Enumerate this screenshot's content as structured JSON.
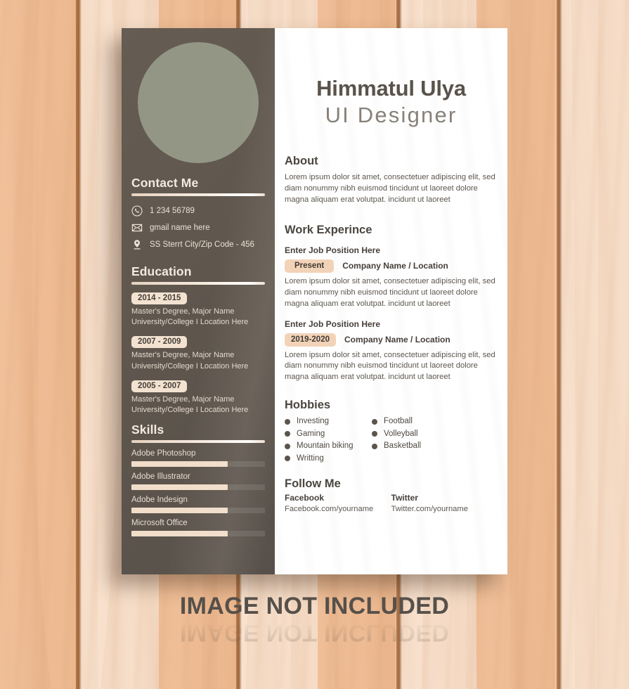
{
  "background": {
    "type": "wood-planks",
    "plank_colors": [
      "#f0c09a",
      "#f8e2cf"
    ],
    "seam_color": "#a36434"
  },
  "card": {
    "left_panel_color": "#5e564d",
    "right_panel_color": "#ffffff",
    "avatar_color": "#939684",
    "accent_light": "#f3e2d0",
    "accent_peach": "#f2d3b8"
  },
  "header": {
    "name": "Himmatul Ulya",
    "title": "UI Designer"
  },
  "sidebar": {
    "avatar_name": "profile-photo-placeholder",
    "contact": {
      "heading": "Contact Me",
      "items": [
        {
          "icon": "phone-icon",
          "value": "1 234 56789"
        },
        {
          "icon": "email-icon",
          "value": "gmail name here"
        },
        {
          "icon": "location-icon",
          "value": "SS Sterrt City/Zip Code - 456"
        }
      ]
    },
    "education": {
      "heading": "Education",
      "items": [
        {
          "dates": "2014 - 2015",
          "degree": "Master's Degree, Major Name",
          "institution": "University/College I  Location Here"
        },
        {
          "dates": "2007 - 2009",
          "degree": "Master's Degree, Major Name",
          "institution": "University/College I  Location Here"
        },
        {
          "dates": "2005 - 2007",
          "degree": "Master's Degree, Major Name",
          "institution": "University/College I  Location Here"
        }
      ]
    },
    "skills": {
      "heading": "Skills",
      "items": [
        {
          "name": "Adobe Photoshop",
          "percent": 72
        },
        {
          "name": "Adobe Illustrator",
          "percent": 72
        },
        {
          "name": "Adobe Indesign",
          "percent": 72
        },
        {
          "name": "Microsoft Office",
          "percent": 72
        }
      ]
    }
  },
  "main": {
    "about": {
      "heading": "About",
      "text": "Lorem ipsum dolor sit amet, consectetuer adipiscing elit, sed diam nonummy nibh euismod tincidunt ut laoreet dolore magna aliquam erat volutpat. incidunt ut laoreet"
    },
    "experience": {
      "heading": "Work Experince",
      "items": [
        {
          "position": "Enter Job Position Here",
          "dates": "Present",
          "company": "Company Name / Location",
          "text": "Lorem ipsum dolor sit amet, consectetuer adipiscing elit, sed diam nonummy nibh euismod tincidunt ut laoreet dolore magna aliquam erat volutpat. incidunt ut laoreet"
        },
        {
          "position": "Enter Job Position Here",
          "dates": "2019-2020",
          "company": "Company Name / Location",
          "text": "Lorem ipsum dolor sit amet, consectetuer adipiscing elit, sed diam nonummy nibh euismod tincidunt ut laoreet dolore magna aliquam erat volutpat. incidunt ut laoreet"
        }
      ]
    },
    "hobbies": {
      "heading": "Hobbies",
      "column_one": [
        "Investing",
        "Gaming",
        "Mountain biking",
        "Writting"
      ],
      "column_two": [
        "Football",
        "Volleyball",
        "Basketball"
      ]
    },
    "follow": {
      "heading": "Follow Me",
      "items": [
        {
          "network": "Facebook",
          "handle": "Facebook.com/yourname"
        },
        {
          "network": "Twitter",
          "handle": "Twitter.com/yourname"
        }
      ]
    }
  },
  "watermark": {
    "text": "IMAGE NOT INCLUDED"
  }
}
